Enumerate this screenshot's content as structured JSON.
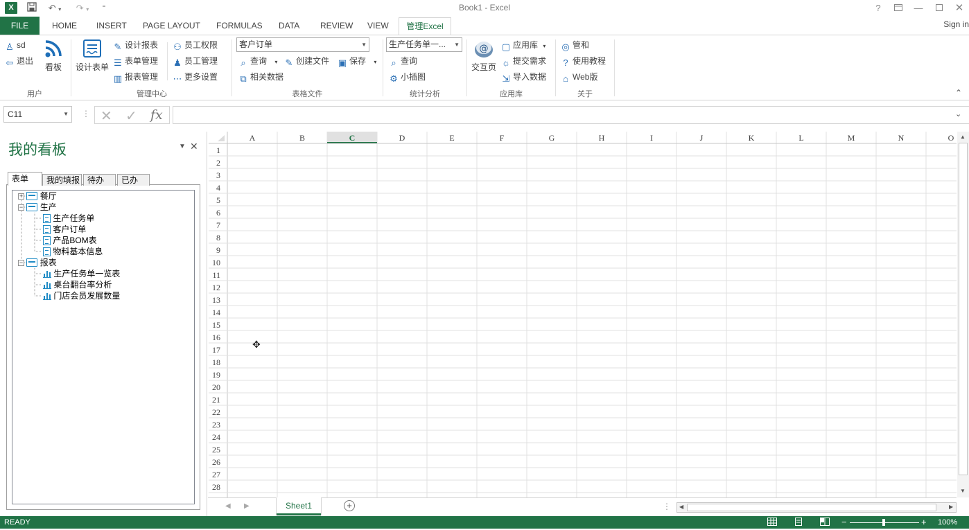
{
  "window": {
    "title": "Book1 - Excel"
  },
  "quick_access": {
    "logo": "X",
    "save_icon": "save-icon",
    "undo_icon": "undo-icon",
    "redo_icon": "redo-icon",
    "customize_icon": "customize-icon"
  },
  "window_controls": {
    "help": "?",
    "restore_ribbon": "restore-ribbon-icon",
    "minimize": "minimize-icon",
    "maximize": "maximize-icon",
    "close": "close-icon"
  },
  "tabs": [
    "FILE",
    "HOME",
    "INSERT",
    "PAGE LAYOUT",
    "FORMULAS",
    "DATA",
    "REVIEW",
    "VIEW",
    "管理Excel"
  ],
  "active_tab": "管理Excel",
  "signin": "Sign in",
  "ribbon": {
    "user": {
      "label": "用户",
      "sd": "sd",
      "logout": "退出",
      "kanban": "看板"
    },
    "admin": {
      "label": "管理中心",
      "design_form": "设计表单",
      "design_report": "设计报表",
      "form_mgmt": "表单管理",
      "report_mgmt": "报表管理",
      "staff_perm": "员工权限",
      "staff_mgmt": "员工管理",
      "more_settings": "更多设置"
    },
    "files": {
      "label": "表格文件",
      "combo_value": "客户订单",
      "query": "查询",
      "create_file": "创建文件",
      "save": "保存",
      "related_data": "相关数据"
    },
    "stats": {
      "label": "统计分析",
      "combo_value": "生产任务单一...",
      "query": "查询",
      "mini_chart": "小插图"
    },
    "apps": {
      "label": "应用库",
      "interact": "交互页",
      "app_store": "应用库",
      "submit_req": "提交需求",
      "import_data": "导入数据"
    },
    "about": {
      "label": "关于",
      "guanhe": "管和",
      "tutorial": "使用教程",
      "web": "Web版"
    }
  },
  "formula_bar": {
    "name_box": "C11",
    "fx": "fx",
    "formula": ""
  },
  "panel": {
    "title": "我的看板",
    "tabs": [
      "表单",
      "我的填报",
      "待办",
      "已办"
    ],
    "active_tab": "表单",
    "tree": [
      {
        "label": "餐厅",
        "type": "folder",
        "expanded": false,
        "level": 0
      },
      {
        "label": "生产",
        "type": "folder",
        "expanded": true,
        "level": 0
      },
      {
        "label": "生产任务单",
        "type": "form",
        "level": 1
      },
      {
        "label": "客户订单",
        "type": "form",
        "level": 1
      },
      {
        "label": "产品BOM表",
        "type": "form",
        "level": 1
      },
      {
        "label": "物料基本信息",
        "type": "form",
        "level": 1
      },
      {
        "label": "报表",
        "type": "folder",
        "expanded": true,
        "level": 0
      },
      {
        "label": "生产任务单一览表",
        "type": "report",
        "level": 1
      },
      {
        "label": "桌台翻台率分析",
        "type": "report",
        "level": 1
      },
      {
        "label": "门店会员发展数量",
        "type": "report",
        "level": 1
      }
    ]
  },
  "sheet": {
    "columns": [
      "A",
      "B",
      "C",
      "D",
      "E",
      "F",
      "G",
      "H",
      "I",
      "J",
      "K",
      "L",
      "M",
      "N",
      "O"
    ],
    "rows": [
      1,
      2,
      3,
      4,
      5,
      6,
      7,
      8,
      9,
      10,
      11,
      12,
      13,
      14,
      15,
      16,
      17,
      18,
      19,
      20,
      21,
      22,
      23,
      24,
      25,
      26,
      27,
      28
    ],
    "active_column": "C",
    "sheet_tabs": [
      "Sheet1"
    ]
  },
  "status": {
    "state": "READY",
    "zoom": "100%"
  },
  "colors": {
    "accent": "#217346",
    "icon_blue": "#1f6fb8"
  }
}
